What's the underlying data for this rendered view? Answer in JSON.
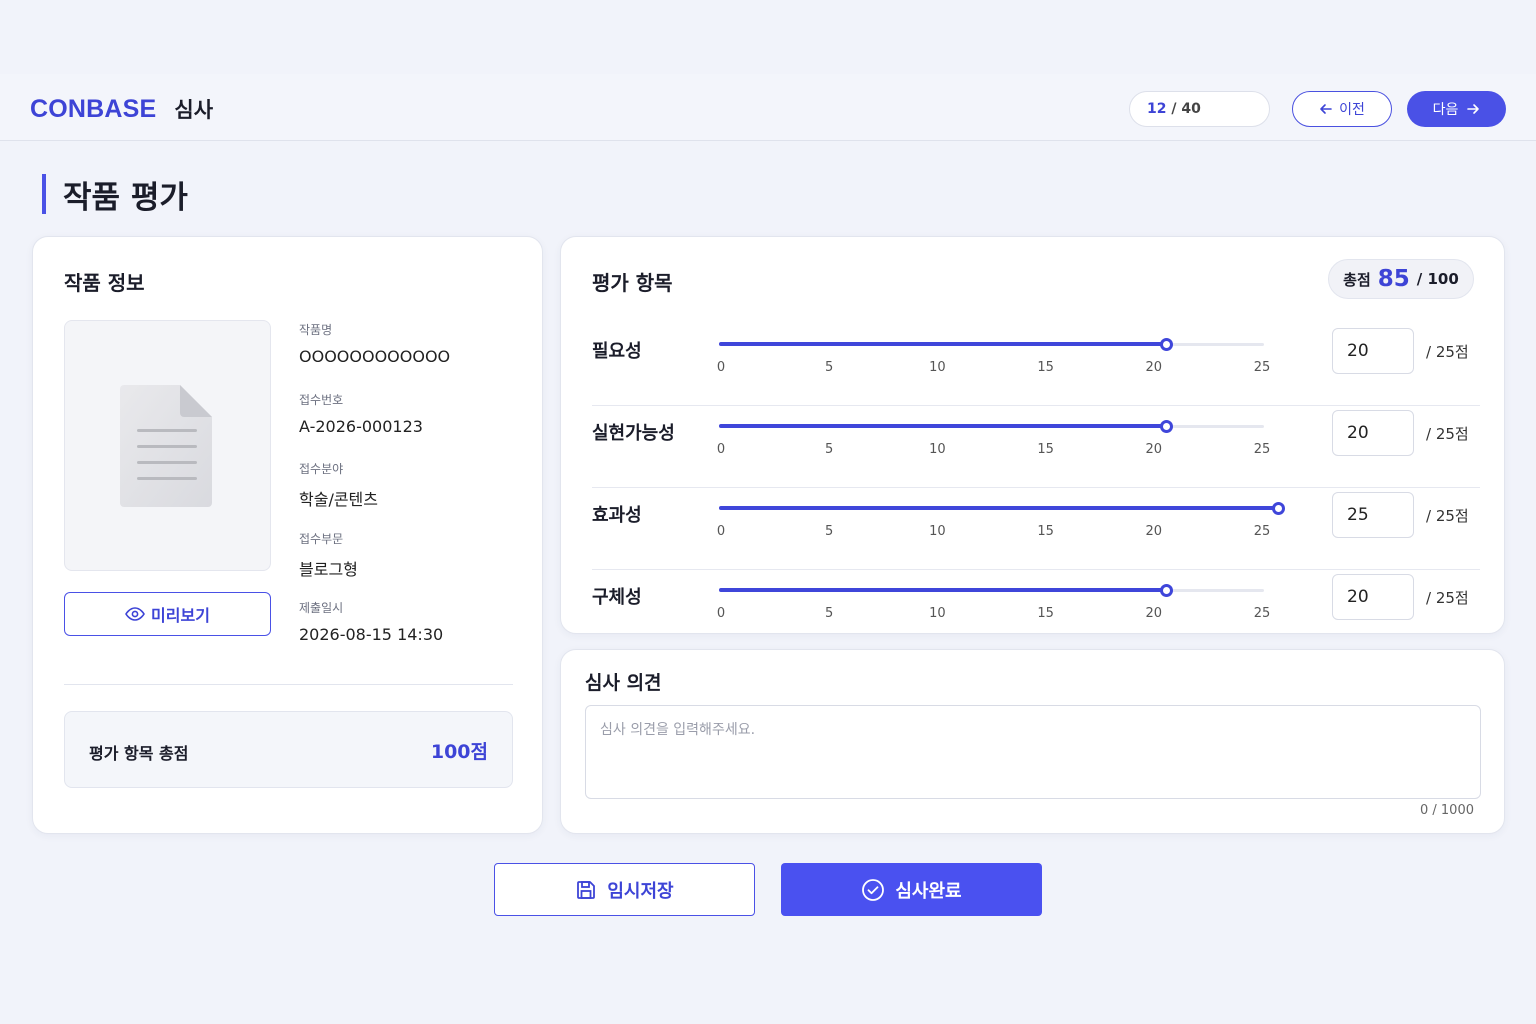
{
  "header": {
    "brand": "CONBASE",
    "section": "심사",
    "counter_current": "12",
    "counter_total": " / 40",
    "prev_label": "이전",
    "next_label": "다음"
  },
  "page": {
    "title": "작품 평가"
  },
  "work_info": {
    "title": "작품 정보",
    "preview_label": "미리보기",
    "fields": [
      {
        "label": "작품명",
        "value": "OOOOOOOOOOOO"
      },
      {
        "label": "접수번호",
        "value": "A-2026-000123"
      },
      {
        "label": "접수분야",
        "value": "학술/콘텐츠"
      },
      {
        "label": "접수부문",
        "value": "블로그형"
      },
      {
        "label": "제출일시",
        "value": "2026-08-15 14:30"
      }
    ],
    "total_label": "평가 항목 총점",
    "total_value": "100점"
  },
  "evaluation": {
    "title": "평가 항목",
    "score_label": "총점",
    "score_value": "85",
    "score_max": "/ 100",
    "ticks": [
      "0",
      "5",
      "10",
      "15",
      "20",
      "25"
    ],
    "slider_max": 25,
    "max_suffix": "/ 25점",
    "items": [
      {
        "label": "필요성",
        "score": 20,
        "score_text": "20"
      },
      {
        "label": "실현가능성",
        "score": 20,
        "score_text": "20"
      },
      {
        "label": "효과성",
        "score": 25,
        "score_text": "25"
      },
      {
        "label": "구체성",
        "score": 20,
        "score_text": "20"
      }
    ]
  },
  "opinion": {
    "title": "심사 의견",
    "placeholder": "심사 의견을 입력해주세요.",
    "count": "0 / 1000"
  },
  "actions": {
    "save_label": "임시저장",
    "complete_label": "심사완료"
  },
  "colors": {
    "accent": "#4a51e6",
    "background": "#f1f3fa"
  }
}
